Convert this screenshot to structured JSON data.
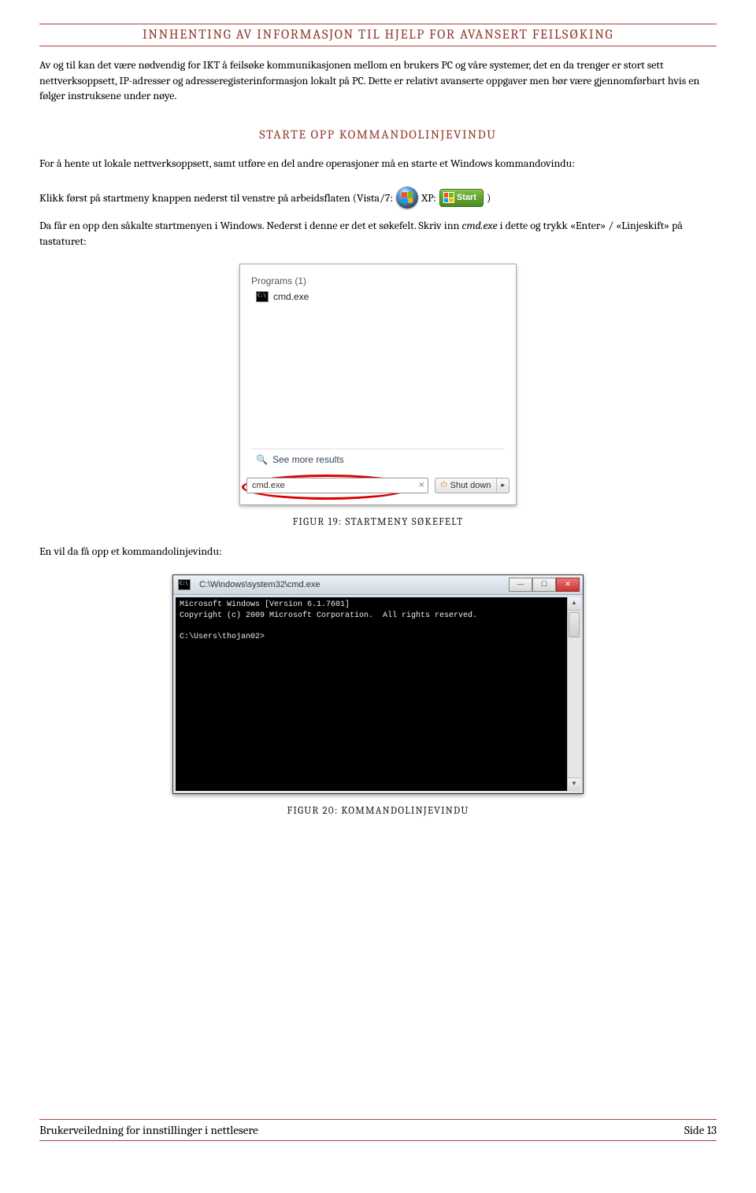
{
  "header": {
    "title": "INNHENTING AV INFORMASJON TIL HJELP FOR AVANSERT FEILSØKING"
  },
  "para1": "Av og til kan det være nødvendig for IKT å feilsøke kommunikasjonen mellom en brukers PC og våre systemer, det en da trenger er stort sett nettverksoppsett, IP-adresser og adresseregisterinformasjon lokalt på PC. Dette er relativt avanserte oppgaver men bør være gjennomførbart hvis en følger instruksene under nøye.",
  "subheading1": "STARTE OPP KOMMANDOLINJEVINDU",
  "para2": "For å hente ut lokale nettverksoppsett, samt utføre en del andre operasjoner må en starte et Windows kommandovindu:",
  "inline": {
    "pre": "Klikk først på startmeny knappen nederst til venstre på arbeidsflaten (Vista/7:",
    "mid": "XP:",
    "xp_label": "Start",
    "post": ")"
  },
  "para3a": "Da får en opp den såkalte startmenyen i Windows. Nederst i denne er det et søkefelt. Skriv inn ",
  "para3_cmd": "cmd.exe",
  "para3b": " i dette og trykk «Enter» / «Linjeskift» på tastaturet:",
  "startmenu": {
    "programs_label": "Programs (1)",
    "item": "cmd.exe",
    "see_more": "See more results",
    "search_value": "cmd.exe",
    "shutdown": "Shut down"
  },
  "caption1": "FIGUR 19: STARTMENY SØKEFELT",
  "para4": "En vil da få opp et kommandolinjevindu:",
  "cmdwin": {
    "title": "C:\\Windows\\system32\\cmd.exe",
    "line1": "Microsoft Windows [Version 6.1.7601]",
    "line2": "Copyright (c) 2009 Microsoft Corporation.  All rights reserved.",
    "prompt": "C:\\Users\\thojan02>"
  },
  "caption2": "FIGUR 20: KOMMANDOLINJEVINDU",
  "footer": {
    "left": "Brukerveiledning for innstillinger i nettlesere",
    "right": "Side 13"
  }
}
